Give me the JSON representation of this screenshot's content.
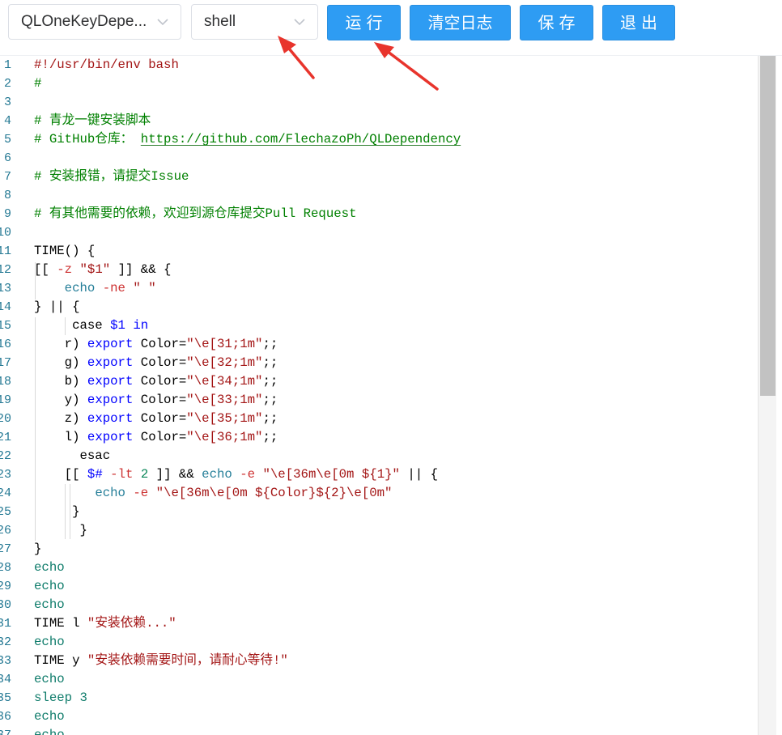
{
  "toolbar": {
    "script_select_value": "QLOneKeyDepe...",
    "lang_select_value": "shell",
    "run_label": "运行",
    "clear_log_label": "清空日志",
    "save_label": "保存",
    "exit_label": "退出"
  },
  "colors": {
    "button_blue": "#2e9cf3",
    "annotation_arrow": "#e8342c"
  },
  "icons": {
    "select_chevron": "chevron-down-icon",
    "annotation": "red-arrow"
  },
  "editor": {
    "lines": [
      {
        "n": "1",
        "t": [
          {
            "c": "shebang",
            "s": "#!/usr/bin/env bash"
          }
        ]
      },
      {
        "n": "2",
        "t": [
          {
            "c": "comment",
            "s": "#"
          }
        ]
      },
      {
        "n": "3",
        "t": []
      },
      {
        "n": "4",
        "t": [
          {
            "c": "comment",
            "s": "# 青龙一键安装脚本"
          }
        ]
      },
      {
        "n": "5",
        "t": [
          {
            "c": "comment",
            "s": "# GitHub仓库： "
          },
          {
            "c": "link",
            "s": "https://github.com/FlechazoPh/QLDependency"
          }
        ]
      },
      {
        "n": "6",
        "t": []
      },
      {
        "n": "7",
        "t": [
          {
            "c": "comment",
            "s": "# 安装报错，请提交Issue"
          }
        ]
      },
      {
        "n": "8",
        "t": []
      },
      {
        "n": "9",
        "t": [
          {
            "c": "comment",
            "s": "# 有其他需要的依赖，欢迎到源仓库提交Pull Request"
          }
        ]
      },
      {
        "n": "10",
        "t": []
      },
      {
        "n": "11",
        "t": [
          {
            "c": "text",
            "s": "TIME() {"
          }
        ]
      },
      {
        "n": "12",
        "t": [
          {
            "c": "text",
            "s": "[[ "
          },
          {
            "c": "flag",
            "s": "-z"
          },
          {
            "c": "text",
            "s": " "
          },
          {
            "c": "str",
            "s": "\"$1\""
          },
          {
            "c": "text",
            "s": " ]] && {"
          }
        ]
      },
      {
        "n": "13",
        "t": [
          {
            "c": "text",
            "s": "    "
          },
          {
            "c": "builtin",
            "s": "echo"
          },
          {
            "c": "text",
            "s": " "
          },
          {
            "c": "flag",
            "s": "-ne"
          },
          {
            "c": "text",
            "s": " "
          },
          {
            "c": "str",
            "s": "\" \""
          }
        ]
      },
      {
        "n": "14",
        "t": [
          {
            "c": "text",
            "s": "} || {"
          }
        ]
      },
      {
        "n": "15",
        "t": [
          {
            "c": "text",
            "s": "     case "
          },
          {
            "c": "var",
            "s": "$1"
          },
          {
            "c": "text",
            "s": " "
          },
          {
            "c": "kw",
            "s": "in"
          }
        ]
      },
      {
        "n": "16",
        "t": [
          {
            "c": "text",
            "s": "    r) "
          },
          {
            "c": "kw",
            "s": "export"
          },
          {
            "c": "text",
            "s": " Color="
          },
          {
            "c": "str",
            "s": "\"\\e[31;1m\""
          },
          {
            "c": "text",
            "s": ";;"
          }
        ]
      },
      {
        "n": "17",
        "t": [
          {
            "c": "text",
            "s": "    g) "
          },
          {
            "c": "kw",
            "s": "export"
          },
          {
            "c": "text",
            "s": " Color="
          },
          {
            "c": "str",
            "s": "\"\\e[32;1m\""
          },
          {
            "c": "text",
            "s": ";;"
          }
        ]
      },
      {
        "n": "18",
        "t": [
          {
            "c": "text",
            "s": "    b) "
          },
          {
            "c": "kw",
            "s": "export"
          },
          {
            "c": "text",
            "s": " Color="
          },
          {
            "c": "str",
            "s": "\"\\e[34;1m\""
          },
          {
            "c": "text",
            "s": ";;"
          }
        ]
      },
      {
        "n": "19",
        "t": [
          {
            "c": "text",
            "s": "    y) "
          },
          {
            "c": "kw",
            "s": "export"
          },
          {
            "c": "text",
            "s": " Color="
          },
          {
            "c": "str",
            "s": "\"\\e[33;1m\""
          },
          {
            "c": "text",
            "s": ";;"
          }
        ]
      },
      {
        "n": "20",
        "t": [
          {
            "c": "text",
            "s": "    z) "
          },
          {
            "c": "kw",
            "s": "export"
          },
          {
            "c": "text",
            "s": " Color="
          },
          {
            "c": "str",
            "s": "\"\\e[35;1m\""
          },
          {
            "c": "text",
            "s": ";;"
          }
        ]
      },
      {
        "n": "21",
        "t": [
          {
            "c": "text",
            "s": "    l) "
          },
          {
            "c": "kw",
            "s": "export"
          },
          {
            "c": "text",
            "s": " Color="
          },
          {
            "c": "str",
            "s": "\"\\e[36;1m\""
          },
          {
            "c": "text",
            "s": ";;"
          }
        ]
      },
      {
        "n": "22",
        "t": [
          {
            "c": "text",
            "s": "      esac"
          }
        ]
      },
      {
        "n": "23",
        "t": [
          {
            "c": "text",
            "s": "    [[ "
          },
          {
            "c": "var",
            "s": "$#"
          },
          {
            "c": "text",
            "s": " "
          },
          {
            "c": "flag",
            "s": "-lt"
          },
          {
            "c": "text",
            "s": " "
          },
          {
            "c": "num",
            "s": "2"
          },
          {
            "c": "text",
            "s": " ]] && "
          },
          {
            "c": "builtin",
            "s": "echo"
          },
          {
            "c": "text",
            "s": " "
          },
          {
            "c": "flag",
            "s": "-e"
          },
          {
            "c": "text",
            "s": " "
          },
          {
            "c": "str",
            "s": "\"\\e[36m\\e[0m ${1}\""
          },
          {
            "c": "text",
            "s": " || {"
          }
        ]
      },
      {
        "n": "24",
        "t": [
          {
            "c": "text",
            "s": "        "
          },
          {
            "c": "builtin",
            "s": "echo"
          },
          {
            "c": "text",
            "s": " "
          },
          {
            "c": "flag",
            "s": "-e"
          },
          {
            "c": "text",
            "s": " "
          },
          {
            "c": "str",
            "s": "\"\\e[36m\\e[0m ${Color}${2}\\e[0m\""
          }
        ]
      },
      {
        "n": "25",
        "t": [
          {
            "c": "text",
            "s": "     }"
          }
        ]
      },
      {
        "n": "26",
        "t": [
          {
            "c": "text",
            "s": "      }"
          }
        ]
      },
      {
        "n": "27",
        "t": [
          {
            "c": "text",
            "s": "}"
          }
        ]
      },
      {
        "n": "28",
        "t": [
          {
            "c": "echo",
            "s": "echo"
          }
        ]
      },
      {
        "n": "29",
        "t": [
          {
            "c": "echo",
            "s": "echo"
          }
        ]
      },
      {
        "n": "30",
        "t": [
          {
            "c": "echo",
            "s": "echo"
          }
        ]
      },
      {
        "n": "31",
        "t": [
          {
            "c": "text",
            "s": "TIME l "
          },
          {
            "c": "str",
            "s": "\"安装依赖...\""
          }
        ]
      },
      {
        "n": "32",
        "t": [
          {
            "c": "echo",
            "s": "echo"
          }
        ]
      },
      {
        "n": "33",
        "t": [
          {
            "c": "text",
            "s": "TIME y "
          },
          {
            "c": "str",
            "s": "\"安装依赖需要时间，请耐心等待!\""
          }
        ]
      },
      {
        "n": "34",
        "t": [
          {
            "c": "echo",
            "s": "echo"
          }
        ]
      },
      {
        "n": "35",
        "t": [
          {
            "c": "echo",
            "s": "sleep 3"
          }
        ]
      },
      {
        "n": "36",
        "t": [
          {
            "c": "echo",
            "s": "echo"
          }
        ]
      },
      {
        "n": "37",
        "t": [
          {
            "c": "echo",
            "s": "echo"
          }
        ]
      }
    ]
  }
}
